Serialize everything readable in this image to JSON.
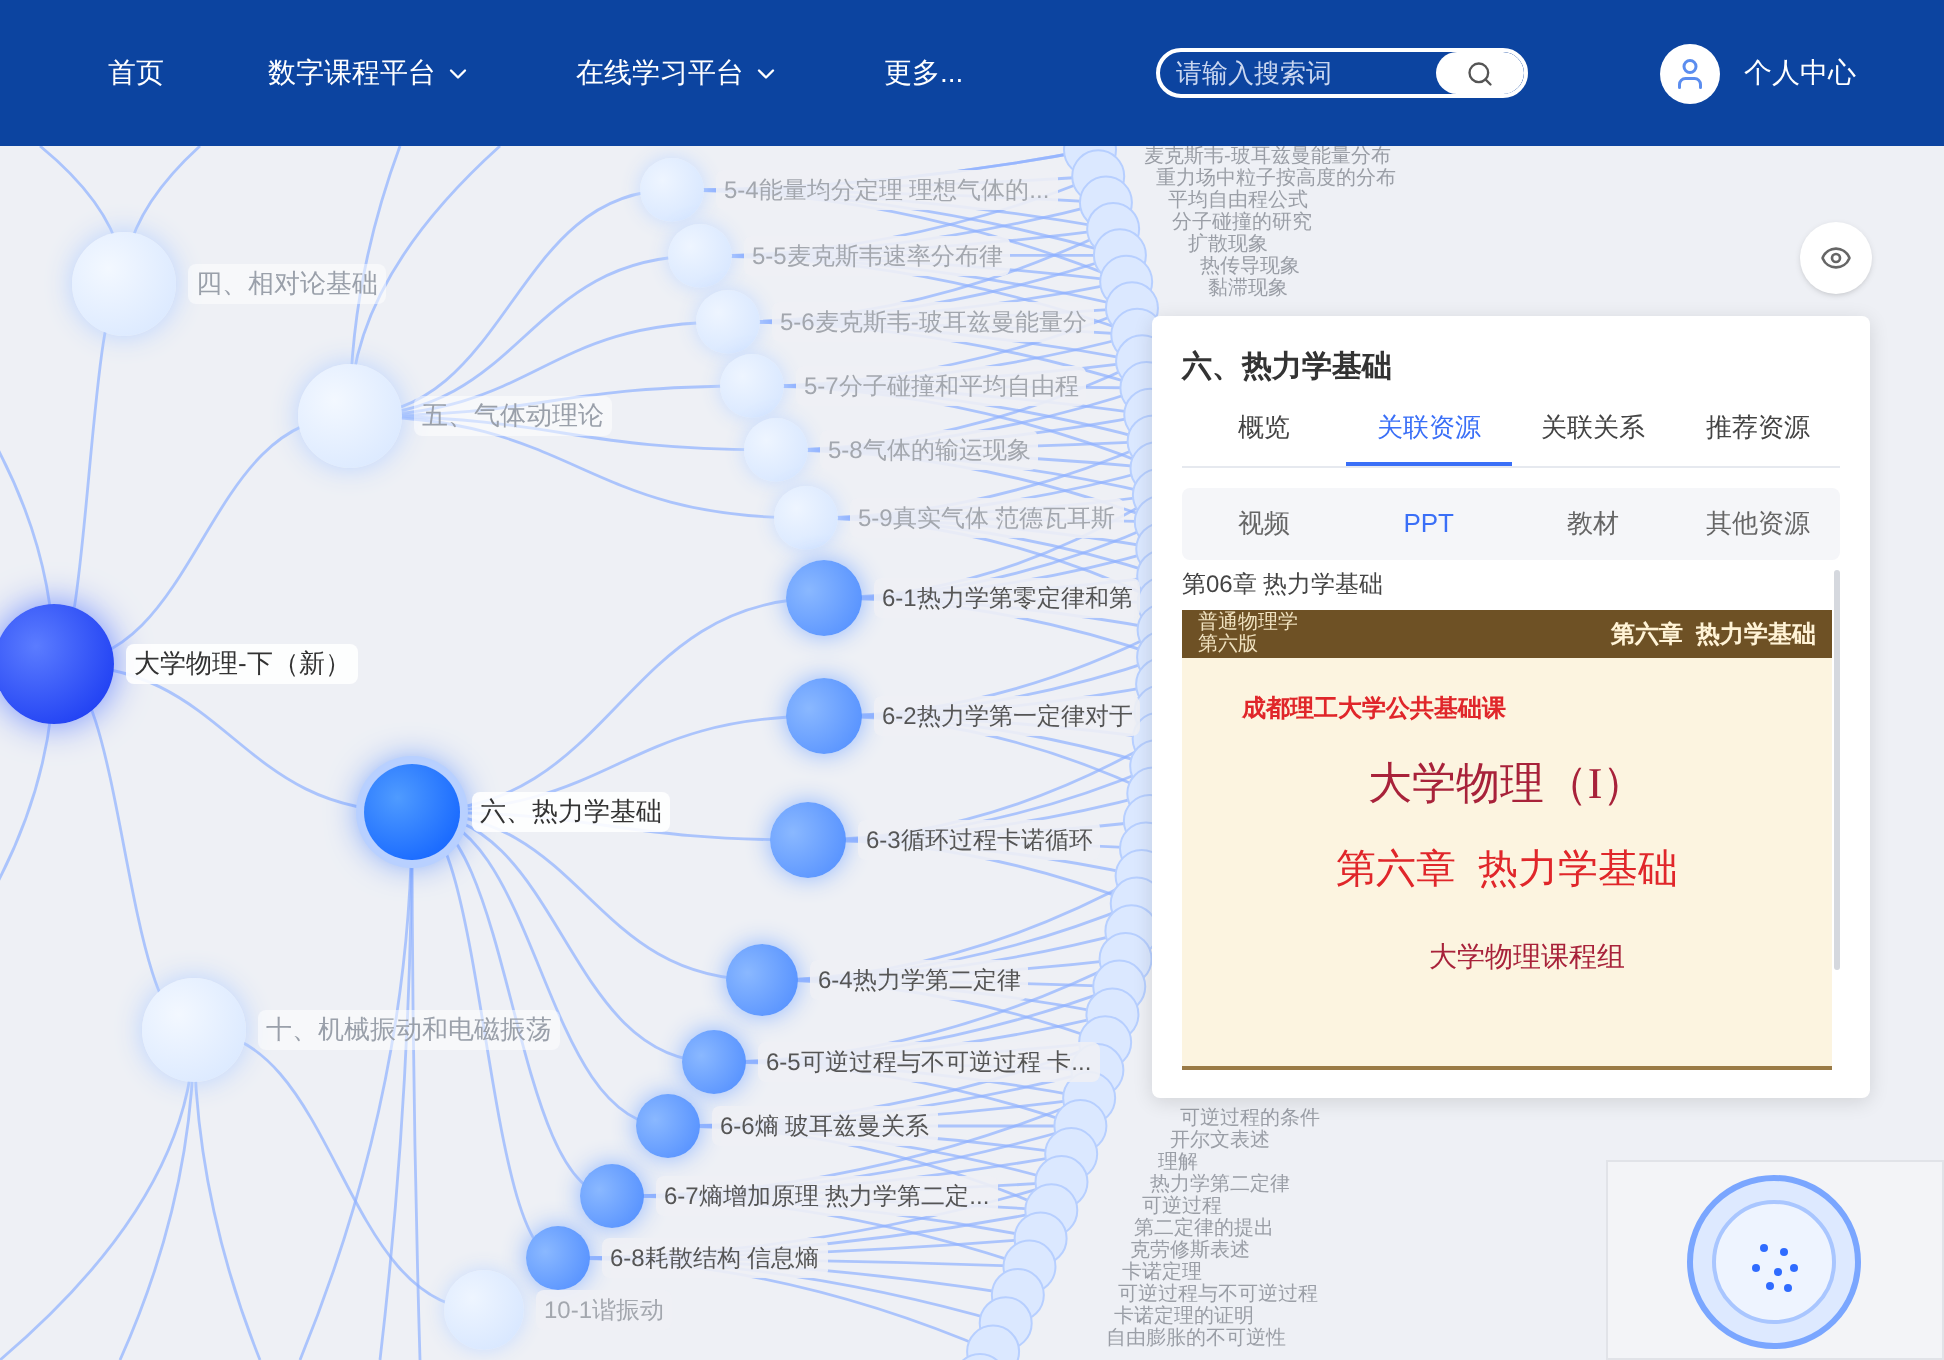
{
  "nav": {
    "items": [
      {
        "label": "首页",
        "has_menu": false
      },
      {
        "label": "数字课程平台",
        "has_menu": true
      },
      {
        "label": "在线学习平台",
        "has_menu": true
      },
      {
        "label": "更多...",
        "has_menu": false
      }
    ],
    "search": {
      "placeholder": "请输入搜索词"
    },
    "user": {
      "label": "个人中心"
    }
  },
  "graph": {
    "nodes": [
      {
        "label": "四、相对论基础",
        "kind": "chapter",
        "selected": false
      },
      {
        "label": "五、气体动理论",
        "kind": "chapter",
        "selected": false
      },
      {
        "label": "大学物理-下（新）",
        "kind": "root",
        "selected": false
      },
      {
        "label": "六、热力学基础",
        "kind": "chapter",
        "selected": true
      },
      {
        "label": "十、机械振动和电磁振荡",
        "kind": "chapter",
        "selected": false
      },
      {
        "label": "5-4能量均分定理 理想气体的...",
        "kind": "faded",
        "selected": false
      },
      {
        "label": "5-5麦克斯韦速率分布律",
        "kind": "faded",
        "selected": false
      },
      {
        "label": "5-6麦克斯韦-玻耳兹曼能量分",
        "kind": "faded",
        "selected": false
      },
      {
        "label": "5-7分子碰撞和平均自由程",
        "kind": "faded",
        "selected": false
      },
      {
        "label": "5-8气体的输运现象",
        "kind": "faded",
        "selected": false
      },
      {
        "label": "5-9真实气体 范德瓦耳斯",
        "kind": "faded",
        "selected": false
      },
      {
        "label": "6-1热力学第零定律和第",
        "kind": "section",
        "selected": false
      },
      {
        "label": "6-2热力学第一定律对于",
        "kind": "section",
        "selected": false
      },
      {
        "label": "6-3循环过程卡诺循环",
        "kind": "section",
        "selected": false
      },
      {
        "label": "6-4热力学第二定律",
        "kind": "section",
        "selected": false
      },
      {
        "label": "6-5可逆过程与不可逆过程 卡...",
        "kind": "section",
        "selected": false
      },
      {
        "label": "6-6熵 玻耳兹曼关系",
        "kind": "section",
        "selected": false
      },
      {
        "label": "6-7熵增加原理 热力学第二定...",
        "kind": "section",
        "selected": false
      },
      {
        "label": "6-8耗散结构 信息熵",
        "kind": "section",
        "selected": false
      },
      {
        "label": "10-1谐振动",
        "kind": "faded",
        "selected": false
      }
    ],
    "leaves_top": [
      "麦克斯韦-玻耳兹曼能量分布",
      "重力场中粒子按高度的分布",
      "平均自由程公式",
      "分子碰撞的研究",
      "扩散现象",
      "热传导现象",
      "黏滞现象"
    ],
    "leaves_bottom": [
      "可逆过程的条件",
      "开尔文表述",
      "理解",
      "热力学第二定律",
      "可逆过程",
      "第二定律的提出",
      "克劳修斯表述",
      "卡诺定理",
      "可逆过程与不可逆过程",
      "卡诺定理的证明",
      "自由膨胀的不可逆性"
    ]
  },
  "panel": {
    "title": "六、热力学基础",
    "tabs": [
      {
        "label": "概览",
        "selected": false
      },
      {
        "label": "关联资源",
        "selected": true
      },
      {
        "label": "关联关系",
        "selected": false
      },
      {
        "label": "推荐资源",
        "selected": false
      }
    ],
    "subtabs": [
      {
        "label": "视频",
        "selected": false
      },
      {
        "label": "PPT",
        "selected": true
      },
      {
        "label": "教材",
        "selected": false
      },
      {
        "label": "其他资源",
        "selected": false
      }
    ],
    "resource_title": "第06章 热力学基础",
    "slide": {
      "book_title": "普通物理学",
      "book_edition": "第六版",
      "header": "第六章  热力学基础",
      "school": "成都理工大学公共基础课",
      "course": "大学物理（I）",
      "chapter": "第六章  热力学基础",
      "group": "大学物理课程组"
    }
  }
}
